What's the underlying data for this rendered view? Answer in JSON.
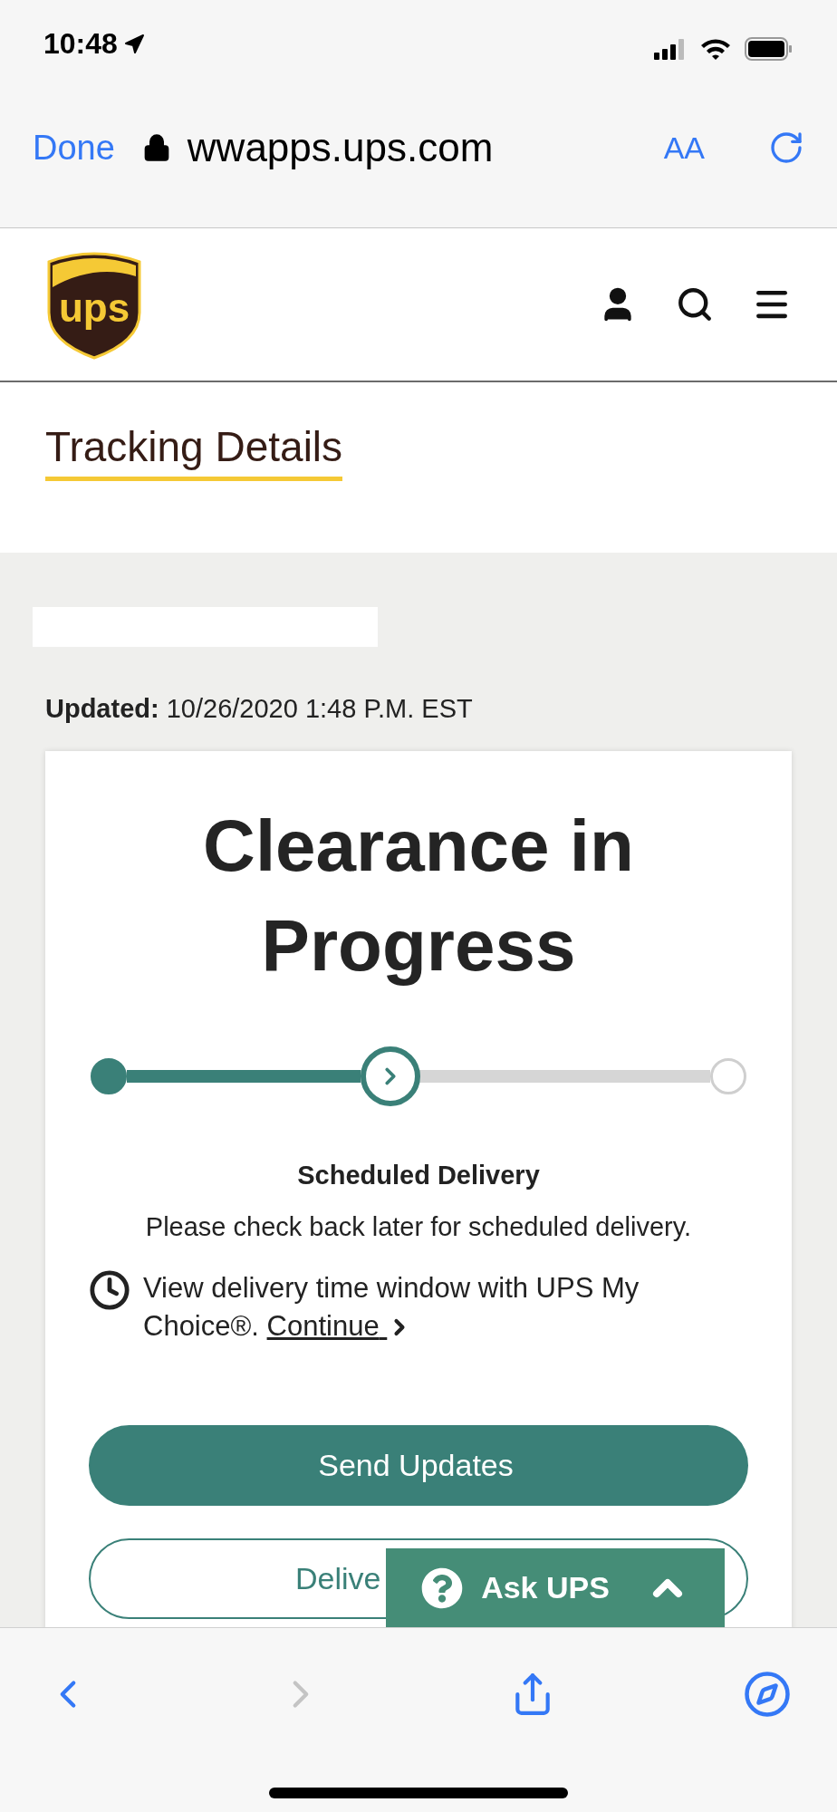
{
  "status_bar": {
    "time": "10:48"
  },
  "browser": {
    "done": "Done",
    "url": "wwapps.ups.com",
    "text_size": "AA"
  },
  "logo_text": "ups",
  "page_title": "Tracking Details",
  "updated": "**Updated:** 10/26/2020 1:48 P.M. EST",
  "status": {
    "heading": "Clearance in Progress",
    "level": 0.4
  },
  "scheduled": {
    "title": "Scheduled Delivery",
    "message": "Please check back later for scheduled delivery."
  },
  "my_choice": {
    "text": "View delivery time window with UPS My Choice®.",
    "link": "Continue"
  },
  "buttons": [
    {
      "label": "Send Updates",
      "kind": "filled"
    },
    {
      "label": "Delive",
      "kind": "outline"
    }
  ],
  "chat": {
    "label": "Ask UPS"
  }
}
